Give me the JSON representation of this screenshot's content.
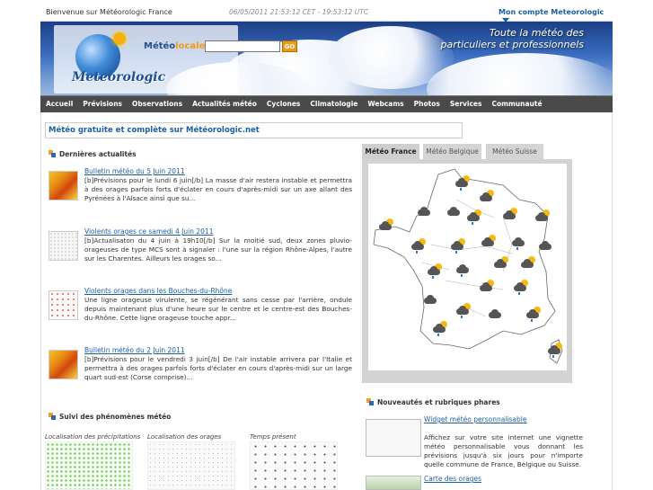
{
  "topbar": {
    "welcome": "Bienvenue sur Météorologic France",
    "datetime": "06/05/2011 21:53:12 CET - 19:53:12 UTC",
    "account": "Mon compte Meteorologic"
  },
  "banner": {
    "brand_meteo": "Météo",
    "brand_locale": "locale",
    "logo": "Meteorologic",
    "search_button": "GO",
    "search_placeholder": "",
    "tagline_line1": "Toute la météo des",
    "tagline_line2": "particuliers et professionnels"
  },
  "nav": {
    "items": [
      "Accueil",
      "Prévisions",
      "Observations",
      "Actualités météo",
      "Cyclones",
      "Climatologie",
      "Webcams",
      "Photos",
      "Services",
      "Communauté"
    ]
  },
  "page": {
    "heading": "Météo gratuite et complète sur Météorologic.net"
  },
  "news": {
    "section_title": "Dernières actualités",
    "items": [
      {
        "title": "Bulletin météo du 5 Juin 2011",
        "body": "[b]Prévisions pour le lundi 6 juin[/b] La masse d'air restera instable et permettra à des orages parfois forts d'éclater en cours d'après-midi sur un axe allant des Pyrénées à l'Alsace ainsi que su..."
      },
      {
        "title": "Violents orages ce samedi 4 Juin 2011",
        "body": "[b]Actualisaton du 4 juin à 19h10[/b] Sur la moitié sud, deux zones pluvio-orageuses de type MCS sont à signaler : l'une sur la région Rhône-Alpes, l'autre sur les Charentes. Ailleurs les orages so..."
      },
      {
        "title": "Violents orages dans les Bouches-du-Rhône",
        "body": "Une ligne orageuse virulente, se régénérant sans cesse par l'arrière, ondule depuis maintenant plus d'une heure sur le centre et le centre-est des Bouches-du-Rhône. Cette ligne orageuse touche appr..."
      },
      {
        "title": "Bulletin météo du 2 Juin 2011",
        "body": "[b]Prévisions pour le vendredi 3 juin[/b] De l'air instable arrivera par l'Italie et permettra à des orages parfois forts d'éclater en cours d'après-midi sur un large quart sud-est (Corse comprise)..."
      }
    ]
  },
  "weather_tabs": {
    "tabs": [
      "Météo France",
      "Météo Belgique",
      "Météo Suisse"
    ],
    "active": "Météo France"
  },
  "phenomena": {
    "section_title": "Suivi des phénomènes météo",
    "labels": [
      "Localisation des précipitations",
      "Localisation des orages",
      "Temps présent"
    ]
  },
  "rubriques": {
    "section_title": "Nouveautés et rubriques phares",
    "widget_title": "Widget météo personnalisable",
    "widget_body": "Affichez sur votre site internet une vignette météo personnalisable vous donnant les prévisions jusqu'à six jours pour n'importe quelle commune de France, Belgique ou Suisse.",
    "carte_title": "Carte des orages"
  },
  "icons": {
    "account_dropdown": "chevron-down-icon",
    "section_bullet": "squares-icon",
    "forecast": "weather-cloud-sun-icon"
  },
  "colors": {
    "link": "#1d5fa6",
    "nav_bg": "#4a4a4a",
    "accent_orange": "#e99a1a"
  }
}
